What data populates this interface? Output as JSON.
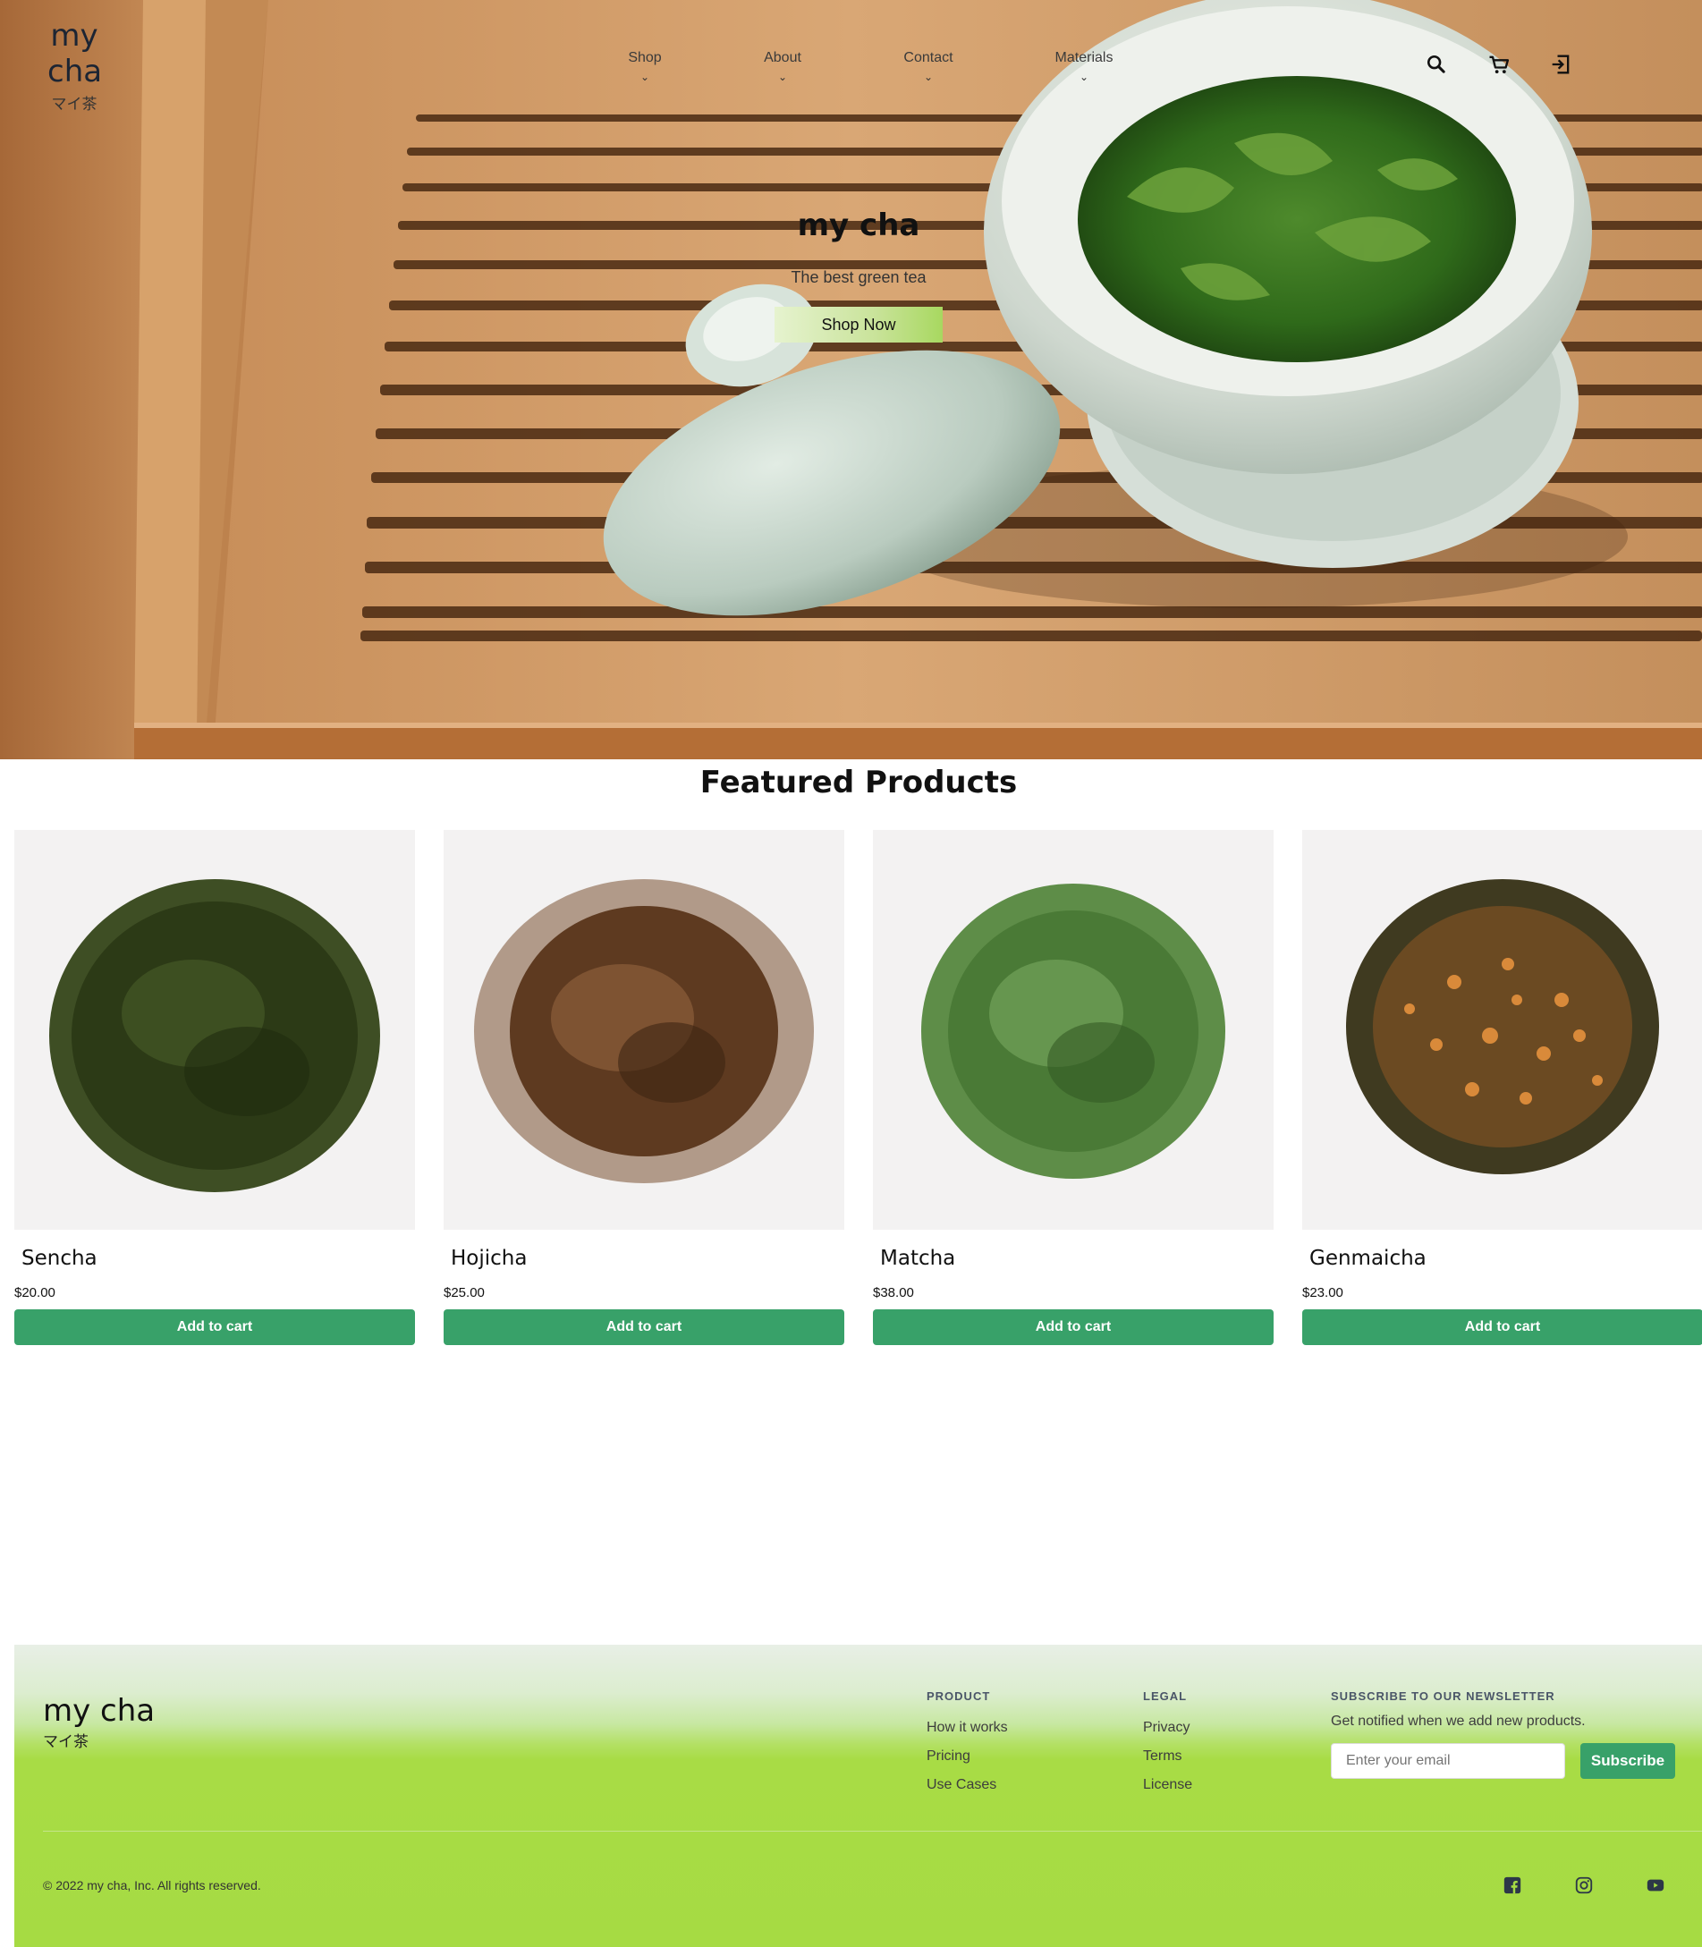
{
  "brand": {
    "logo_line1": "my",
    "logo_line2": "cha",
    "logo_japanese": "マイ茶",
    "accent_green": "#38a169",
    "hero_button_gradient": [
      "#e6f3cf",
      "#a8d860"
    ],
    "footer_green": "#a6db43"
  },
  "nav": {
    "items": [
      {
        "label": "Shop",
        "icon": "chevron-down-icon"
      },
      {
        "label": "About",
        "icon": "chevron-down-icon"
      },
      {
        "label": "Contact",
        "icon": "chevron-down-icon"
      },
      {
        "label": "Materials",
        "icon": "chevron-down-icon"
      }
    ],
    "icons": [
      "search-icon",
      "cart-icon",
      "login-icon"
    ]
  },
  "hero": {
    "title": "my cha",
    "subtitle": "The best green tea",
    "cta_label": "Shop Now"
  },
  "featured": {
    "title": "Featured Products",
    "products": [
      {
        "name": "Sencha",
        "price": "$20.00",
        "button": "Add to cart"
      },
      {
        "name": "Hojicha",
        "price": "$25.00",
        "button": "Add to cart"
      },
      {
        "name": "Matcha",
        "price": "$38.00",
        "button": "Add to cart"
      },
      {
        "name": "Genmaicha",
        "price": "$23.00",
        "button": "Add to cart"
      }
    ]
  },
  "footer": {
    "brand": "my cha",
    "brand_japanese": "マイ茶",
    "product_heading": "PRODUCT",
    "product_links": [
      "How it works",
      "Pricing",
      "Use Cases"
    ],
    "legal_heading": "LEGAL",
    "legal_links": [
      "Privacy",
      "Terms",
      "License"
    ],
    "newsletter_heading": "SUBSCRIBE TO OUR NEWSLETTER",
    "newsletter_text": "Get notified when we add new products.",
    "email_placeholder": "Enter your email",
    "subscribe_label": "Subscribe",
    "copyright": "© 2022 my cha, Inc. All rights reserved.",
    "social_icons": [
      "facebook-icon",
      "instagram-icon",
      "youtube-icon"
    ]
  }
}
